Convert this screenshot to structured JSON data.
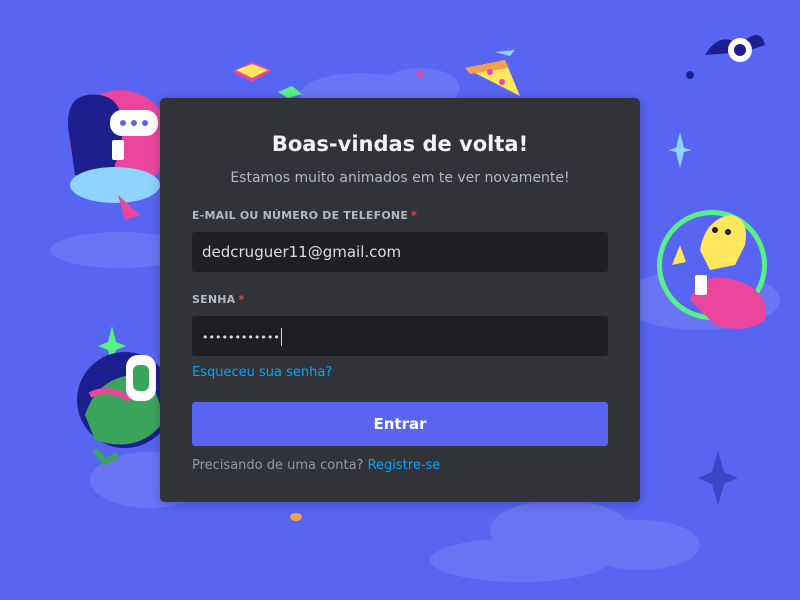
{
  "colors": {
    "background": "#5865f2",
    "card": "#313338",
    "input": "#1e1f22",
    "accent": "#5865f2",
    "link": "#00a8fc",
    "required": "#f23f43"
  },
  "login": {
    "title": "Boas-vindas de volta!",
    "subtitle": "Estamos muito animados em te ver novamente!",
    "email_label": "E-MAIL OU NÚMERO DE TELEFONE",
    "required_mark": "*",
    "email_value": "dedcruguer11@gmail.com",
    "password_label": "SENHA",
    "password_value": "••••••••••••",
    "forgot_link": "Esqueceu sua senha?",
    "submit_label": "Entrar",
    "register_prompt": "Precisando de uma conta?",
    "register_link": "Registre-se"
  },
  "illustrations": [
    "woman-with-phone",
    "flying-book",
    "pizza-slice",
    "eyeball-bat",
    "sparkle",
    "wumpus-with-headphones",
    "yellow-character-waving",
    "clouds"
  ]
}
